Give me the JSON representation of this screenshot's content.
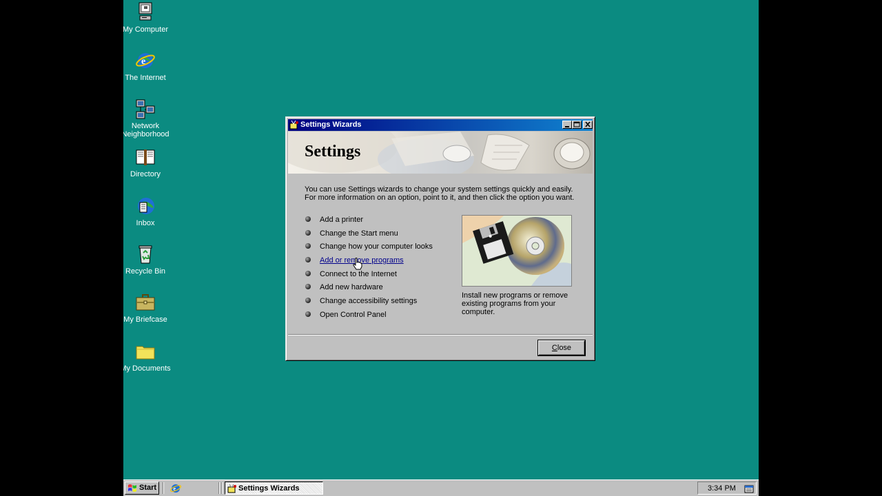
{
  "desktop": {
    "icons": [
      {
        "label": "My Computer",
        "icon": "my-computer-icon"
      },
      {
        "label": "The Internet",
        "icon": "internet-explorer-icon"
      },
      {
        "label": "Network Neighborhood",
        "icon": "network-icon"
      },
      {
        "label": "Directory",
        "icon": "book-icon"
      },
      {
        "label": "Inbox",
        "icon": "inbox-icon"
      },
      {
        "label": "Recycle Bin",
        "icon": "recycle-bin-icon"
      },
      {
        "label": "My Briefcase",
        "icon": "briefcase-icon"
      },
      {
        "label": "My Documents",
        "icon": "folder-icon"
      }
    ],
    "background_color": "#0b8b81"
  },
  "window": {
    "title": "Settings Wizards",
    "banner_title": "Settings",
    "intro": "You can use Settings wizards to change your system settings quickly and easily.  For more information on an option, point to it, and then click the option you want.",
    "options": [
      {
        "label": "Add a printer",
        "active": false
      },
      {
        "label": "Change the Start menu",
        "active": false
      },
      {
        "label": "Change how your computer looks",
        "active": false
      },
      {
        "label": "Add or remove programs",
        "active": true
      },
      {
        "label": "Connect to the Internet",
        "active": false
      },
      {
        "label": "Add new hardware",
        "active": false
      },
      {
        "label": "Change accessibility settings",
        "active": false
      },
      {
        "label": "Open Control Panel",
        "active": false
      }
    ],
    "description": "Install new programs or remove existing programs from your computer.",
    "close_label_mnemonic": "C",
    "close_label_rest": "lose"
  },
  "taskbar": {
    "start_label": "Start",
    "task_label": "Settings Wizards",
    "clock": "3:34 PM"
  },
  "colors": {
    "titlebar": "#000080",
    "link": "#00008b"
  }
}
